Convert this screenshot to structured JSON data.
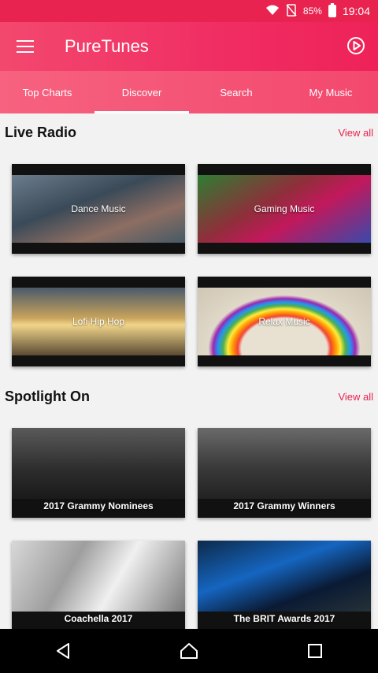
{
  "status_bar": {
    "battery": "85%",
    "time": "19:04",
    "icons": [
      "wifi-icon",
      "no-sim-icon",
      "battery-icon"
    ]
  },
  "app_bar": {
    "title": "PureTunes",
    "menu_icon": "menu-icon",
    "action_icon": "play-circle-icon"
  },
  "tabs": [
    {
      "label": "Top Charts",
      "active": false
    },
    {
      "label": "Discover",
      "active": true
    },
    {
      "label": "Search",
      "active": false
    },
    {
      "label": "My Music",
      "active": false
    }
  ],
  "live_radio": {
    "title": "Live Radio",
    "view_all": "View all",
    "items": [
      {
        "label": "Dance Music"
      },
      {
        "label": "Gaming Music"
      },
      {
        "label": "Lofi Hip Hop"
      },
      {
        "label": "Relax Music"
      }
    ]
  },
  "spotlight": {
    "title": "Spotlight On",
    "view_all": "View all",
    "items": [
      {
        "label": "2017 Grammy Nominees"
      },
      {
        "label": "2017 Grammy Winners"
      },
      {
        "label": "Coachella 2017"
      },
      {
        "label": "The BRIT Awards 2017"
      }
    ]
  },
  "nav_bar": {
    "icons": [
      "back-icon",
      "home-icon",
      "recents-icon"
    ]
  },
  "colors": {
    "accent": "#e8234f",
    "tab_bar": "#f3486e"
  }
}
